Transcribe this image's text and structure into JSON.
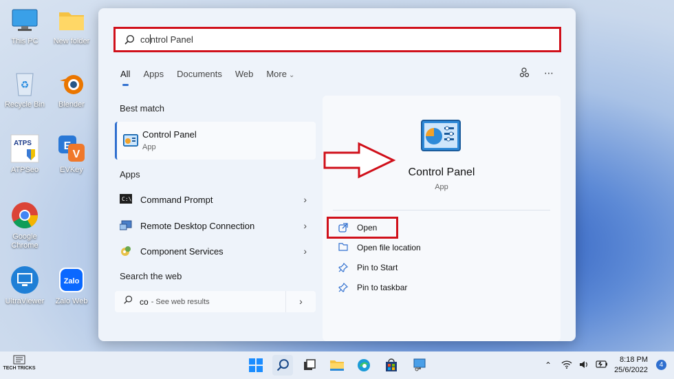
{
  "desktop": {
    "icons": [
      {
        "label": "This PC",
        "icon": "monitor-icon"
      },
      {
        "label": "New folder",
        "icon": "folder-icon"
      },
      {
        "label": "Recycle Bin",
        "icon": "recycle-bin-icon"
      },
      {
        "label": "Blender",
        "icon": "blender-icon"
      },
      {
        "label": "ATPSeo",
        "icon": "atpseo-icon"
      },
      {
        "label": "EVKey",
        "icon": "evkey-icon"
      },
      {
        "label": "Google\nChrome",
        "icon": "chrome-icon"
      },
      {
        "label": "UltraViewer",
        "icon": "ultraviewer-icon"
      },
      {
        "label": "Zalo Web",
        "icon": "zalo-icon"
      }
    ]
  },
  "search": {
    "query_typed": "co",
    "query_rest": "ntrol Panel"
  },
  "tabs": [
    {
      "label": "All"
    },
    {
      "label": "Apps"
    },
    {
      "label": "Documents"
    },
    {
      "label": "Web"
    },
    {
      "label": "More"
    }
  ],
  "left": {
    "best_match_heading": "Best match",
    "best_match": {
      "title": "Control Panel",
      "subtitle": "App"
    },
    "apps_heading": "Apps",
    "apps": [
      {
        "label": "Command Prompt",
        "icon": "cmd-icon"
      },
      {
        "label": "Remote Desktop Connection",
        "icon": "remote-desktop-icon"
      },
      {
        "label": "Component Services",
        "icon": "component-services-icon"
      }
    ],
    "web_heading": "Search the web",
    "web": {
      "query": "co",
      "suffix": "- See web results"
    }
  },
  "right": {
    "title": "Control Panel",
    "subtitle": "App",
    "actions": [
      {
        "label": "Open",
        "icon": "open-external-icon"
      },
      {
        "label": "Open file location",
        "icon": "folder-outline-icon"
      },
      {
        "label": "Pin to Start",
        "icon": "pin-icon"
      },
      {
        "label": "Pin to taskbar",
        "icon": "pin-icon"
      }
    ]
  },
  "taskbar": {
    "time": "8:18 PM",
    "date": "25/6/2022",
    "notifications": "4"
  },
  "brand": {
    "name": "TECH TRICKS"
  },
  "colors": {
    "highlight_red": "#d0101a",
    "accent_blue": "#2f6fcf"
  }
}
